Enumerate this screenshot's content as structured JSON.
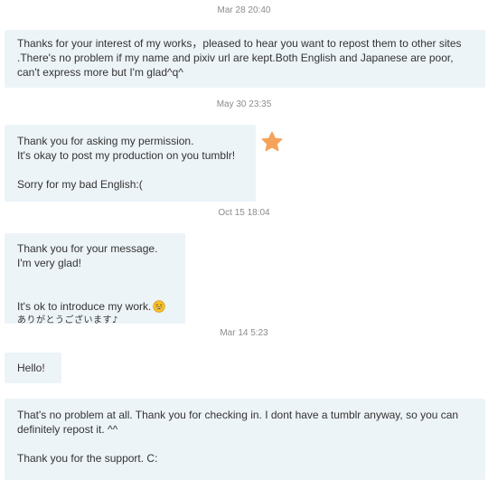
{
  "thread": {
    "messages": [
      {
        "timestamp": "Mar 28 20:40",
        "lines": [
          "Thanks for your interest of my works，pleased to hear you want to repost them to other sites .There's no problem if my name and pixiv url are kept.Both English and Japanese are poor, can't express more but I'm glad^q^"
        ]
      },
      {
        "timestamp": "May 30 23:35",
        "line1": "Thank you for asking my permission.",
        "line2": "It's okay to post my production on you tumblr!",
        "line3": "Sorry for my bad English:("
      },
      {
        "timestamp": "Oct 15 18:04",
        "line1": "Thank you for your message.",
        "line2": "I'm very glad!",
        "line3": "It's ok to introduce my work.",
        "line4": "ありがとうございます♪"
      },
      {
        "timestamp": "Mar 14 5:23",
        "line1": "Hello!"
      },
      {
        "line1": "That's no problem at all. Thank you for checking in. I dont have a tumblr anyway, so you can definitely repost it. ^^",
        "line2": "Thank you for the support. C:"
      }
    ]
  },
  "icons": {
    "favorite": "star-icon",
    "emoji": "grinning-face-emoji"
  },
  "colors": {
    "bubble_bg": "#edf4f8",
    "timestamp": "#8c8c8c",
    "text": "#333333",
    "star": "#f5a35a",
    "emoji": "#f6c02a"
  }
}
